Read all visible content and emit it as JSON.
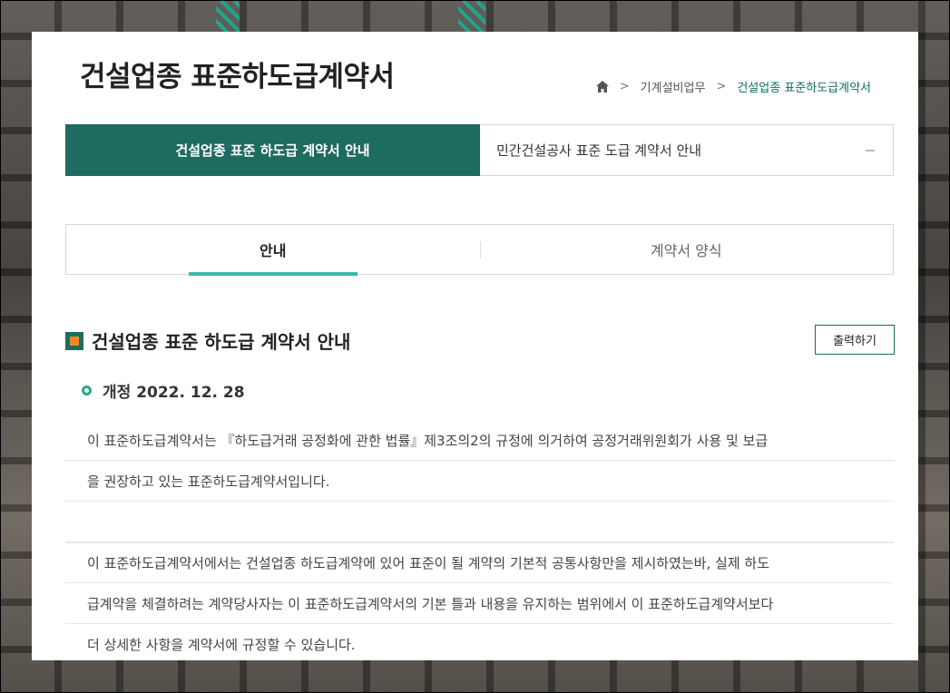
{
  "page": {
    "title": "건설업종 표준하도급계약서"
  },
  "breadcrumb": {
    "home_icon": "home-icon",
    "items": [
      "기계설비업무",
      "건설업종 표준하도급계약서"
    ]
  },
  "main_tabs": [
    {
      "label": "건설업종 표준 하도급 계약서 안내",
      "active": true
    },
    {
      "label": "민간건설공사 표준 도급 계약서 안내",
      "active": false
    }
  ],
  "sub_tabs": [
    {
      "label": "안내",
      "active": true
    },
    {
      "label": "계약서 양식",
      "active": false
    }
  ],
  "section": {
    "title": "건설업종 표준 하도급 계약서 안내",
    "print_label": "출력하기",
    "revision": "개정 2022. 12. 28"
  },
  "paragraphs": [
    [
      "이 표준하도급계약서는 『하도급거래 공정화에 관한 법률』제3조의2의 규정에 의거하여 공정거래위원회가 사용 및 보급",
      "을 권장하고 있는 표준하도급계약서입니다."
    ],
    [
      "이 표준하도급계약서에서는 건설업종 하도급계약에 있어 표준이 될 계약의 기본적 공통사항만을 제시하였는바, 실제 하도",
      "급계약을 체결하려는 계약당사자는 이 표준하도급계약서의 기본 틀과 내용을 유지하는 범위에서 이 표준하도급계약서보다",
      "더 상세한 사항을 계약서에 규정할 수 있습니다."
    ]
  ],
  "colors": {
    "accent": "#1e6b60",
    "tab_underline": "#3fb9a6",
    "icon_orange": "#f08a24"
  }
}
